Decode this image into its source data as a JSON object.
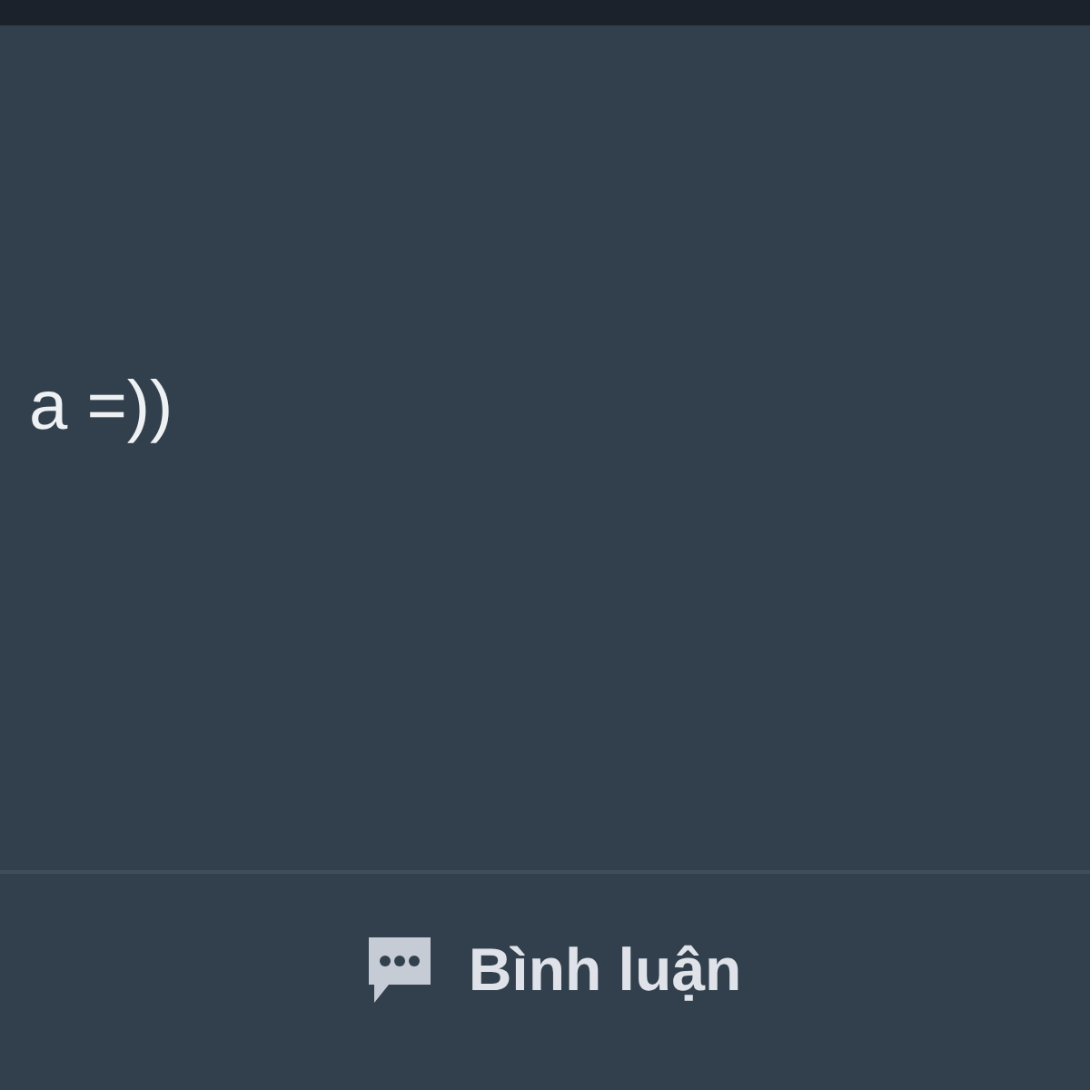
{
  "post": {
    "text": "a =))"
  },
  "actions": [
    {
      "kind": "comment",
      "label": "Bình luận"
    }
  ]
}
